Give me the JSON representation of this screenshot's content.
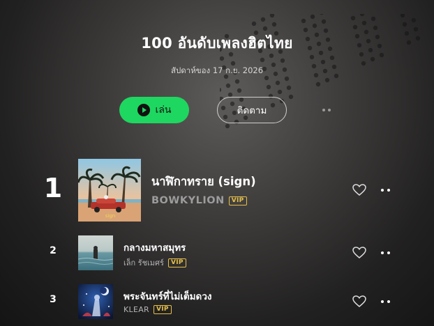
{
  "header": {
    "title": "100 อันดับเพลงฮิตไทย",
    "subtitle": "สัปดาห์ของ 17 ก.ย. 2026"
  },
  "actions": {
    "play_label": "เล่น",
    "follow_label": "ติดตาม"
  },
  "songs": [
    {
      "rank": "1",
      "title": "นาฬิกาทราย (sign)",
      "artist": "BOWKYLION",
      "badge": "VIP"
    },
    {
      "rank": "2",
      "title": "กลางมหาสมุทร",
      "artist": "เล็ก รัชเมศร์",
      "badge": "VIP"
    },
    {
      "rank": "3",
      "title": "พระจันทร์ที่ไม่เต็มดวง",
      "artist": "KLEAR",
      "badge": "VIP"
    }
  ],
  "icons": {
    "play": "play-icon",
    "more": "more-icon",
    "heart": "heart-icon"
  },
  "colors": {
    "accent": "#1ed760",
    "vip": "#e6c04a"
  }
}
